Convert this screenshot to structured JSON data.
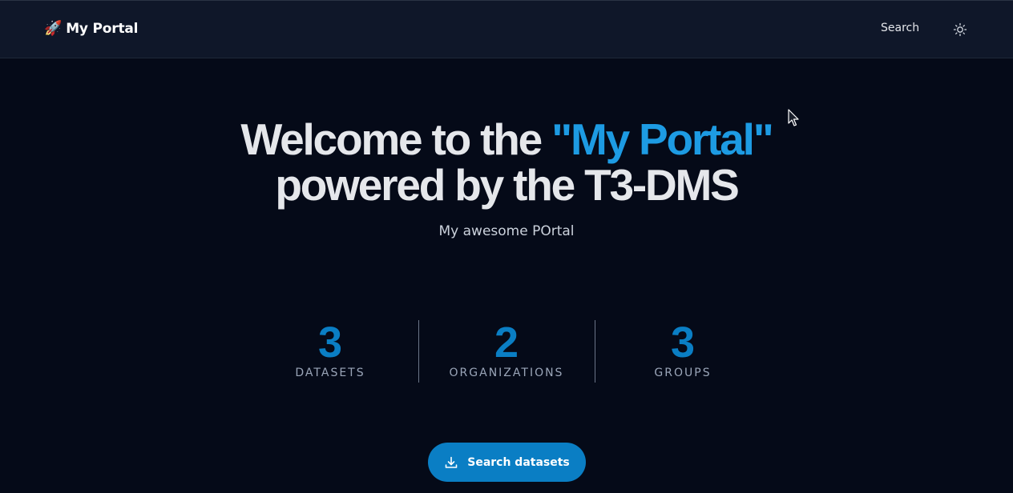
{
  "header": {
    "brand_icon": "🚀",
    "brand_label": "My Portal",
    "search_label": "Search",
    "theme_icon": "sun-icon"
  },
  "hero": {
    "title_prefix": "Welcome to the ",
    "title_accent": "\"My Portal\"",
    "title_line2": "powered by the T3-DMS",
    "subtitle": "My awesome POrtal",
    "accent_color": "#1d9be3"
  },
  "stats": [
    {
      "value": "3",
      "label": "DATASETS"
    },
    {
      "value": "2",
      "label": "ORGANIZATIONS"
    },
    {
      "value": "3",
      "label": "GROUPS"
    }
  ],
  "cta": {
    "label": "Search datasets",
    "icon": "download-icon",
    "color": "#0a7ec4"
  }
}
